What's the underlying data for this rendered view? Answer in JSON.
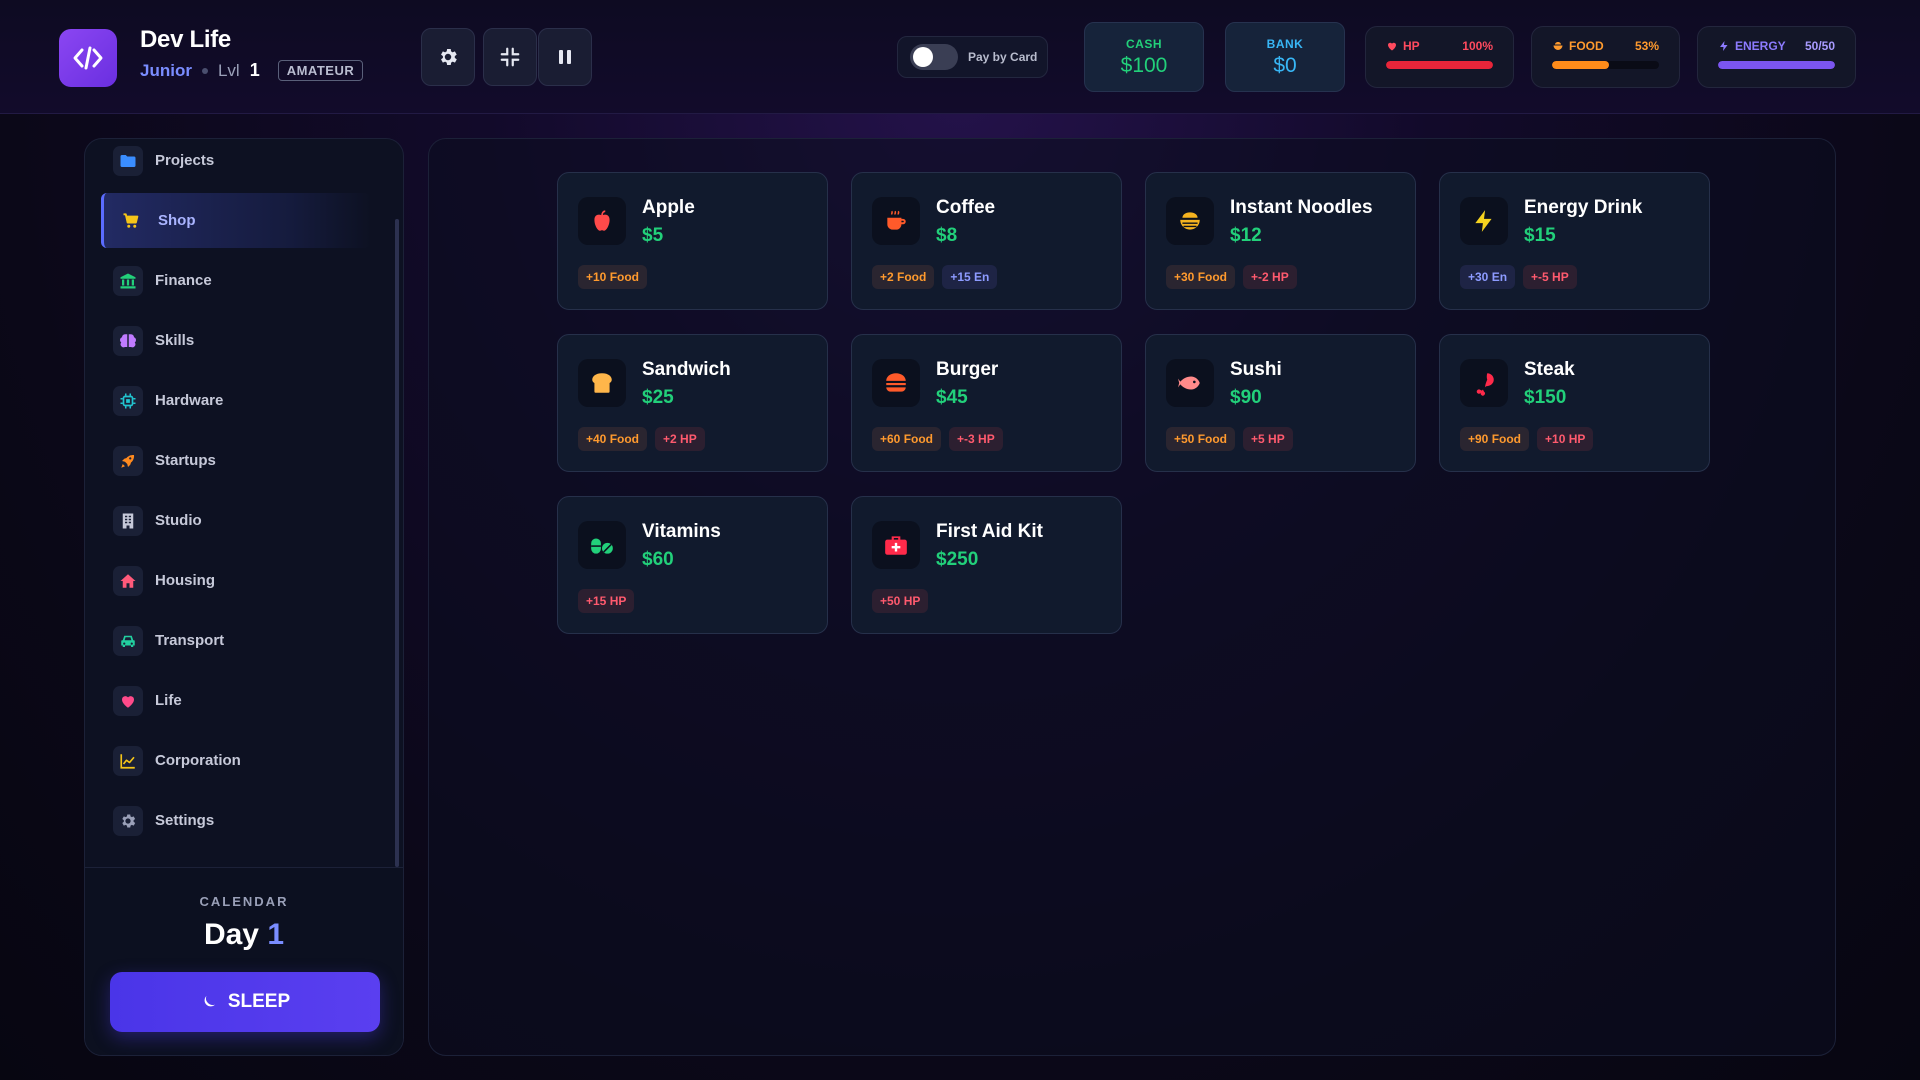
{
  "app": {
    "title": "Dev Life"
  },
  "player": {
    "rank": "Junior",
    "lvl_label": "Lvl",
    "lvl": "1",
    "badge": "AMATEUR"
  },
  "controls": {
    "pay_by_card_label": "Pay by Card",
    "pay_by_card_enabled": false
  },
  "money": {
    "cash_label": "CASH",
    "cash_value": "$100",
    "bank_label": "BANK",
    "bank_value": "$0"
  },
  "stats": {
    "hp": {
      "label": "HP",
      "value": "100%",
      "fill": 1.0,
      "color": "#e8253a"
    },
    "food": {
      "label": "FOOD",
      "value": "53%",
      "fill": 0.53,
      "color": "#ff8c1a"
    },
    "energy": {
      "label": "ENERGY",
      "value": "50/50",
      "fill": 1.0,
      "color": "#7b55f0"
    }
  },
  "sidebar": {
    "items": [
      {
        "label": "Projects",
        "icon": "folder-icon"
      },
      {
        "label": "Shop",
        "icon": "cart-icon",
        "active": true
      },
      {
        "label": "Finance",
        "icon": "bank-icon"
      },
      {
        "label": "Skills",
        "icon": "brain-icon"
      },
      {
        "label": "Hardware",
        "icon": "chip-icon"
      },
      {
        "label": "Startups",
        "icon": "rocket-icon"
      },
      {
        "label": "Studio",
        "icon": "building-icon"
      },
      {
        "label": "Housing",
        "icon": "house-icon"
      },
      {
        "label": "Transport",
        "icon": "car-icon"
      },
      {
        "label": "Life",
        "icon": "heart-icon"
      },
      {
        "label": "Corporation",
        "icon": "chart-icon"
      },
      {
        "label": "Settings",
        "icon": "gear-icon"
      }
    ],
    "calendar_label": "CALENDAR",
    "day_label": "Day",
    "day_value": "1",
    "sleep_label": "SLEEP"
  },
  "shop": {
    "items": [
      {
        "name": "Apple",
        "price": "$5",
        "icon": "apple-icon",
        "tags": [
          {
            "text": "+10 Food",
            "kind": "food"
          }
        ]
      },
      {
        "name": "Coffee",
        "price": "$8",
        "icon": "coffee-icon",
        "tags": [
          {
            "text": "+2 Food",
            "kind": "food"
          },
          {
            "text": "+15 En",
            "kind": "en"
          }
        ]
      },
      {
        "name": "Instant Noodles",
        "price": "$12",
        "icon": "noodles-icon",
        "tags": [
          {
            "text": "+30 Food",
            "kind": "food"
          },
          {
            "text": "+-2 HP",
            "kind": "hp"
          }
        ]
      },
      {
        "name": "Energy Drink",
        "price": "$15",
        "icon": "bolt-icon",
        "tags": [
          {
            "text": "+30 En",
            "kind": "en"
          },
          {
            "text": "+-5 HP",
            "kind": "hp"
          }
        ]
      },
      {
        "name": "Sandwich",
        "price": "$25",
        "icon": "bread-icon",
        "tags": [
          {
            "text": "+40 Food",
            "kind": "food"
          },
          {
            "text": "+2 HP",
            "kind": "hp"
          }
        ]
      },
      {
        "name": "Burger",
        "price": "$45",
        "icon": "burger-icon",
        "tags": [
          {
            "text": "+60 Food",
            "kind": "food"
          },
          {
            "text": "+-3 HP",
            "kind": "hp"
          }
        ]
      },
      {
        "name": "Sushi",
        "price": "$90",
        "icon": "fish-icon",
        "tags": [
          {
            "text": "+50 Food",
            "kind": "food"
          },
          {
            "text": "+5 HP",
            "kind": "hp"
          }
        ]
      },
      {
        "name": "Steak",
        "price": "$150",
        "icon": "drumstick-icon",
        "tags": [
          {
            "text": "+90 Food",
            "kind": "food"
          },
          {
            "text": "+10 HP",
            "kind": "hp"
          }
        ]
      },
      {
        "name": "Vitamins",
        "price": "$60",
        "icon": "pills-icon",
        "tags": [
          {
            "text": "+15 HP",
            "kind": "hp"
          }
        ]
      },
      {
        "name": "First Aid Kit",
        "price": "$250",
        "icon": "medkit-icon",
        "tags": [
          {
            "text": "+50 HP",
            "kind": "hp"
          }
        ]
      }
    ]
  }
}
